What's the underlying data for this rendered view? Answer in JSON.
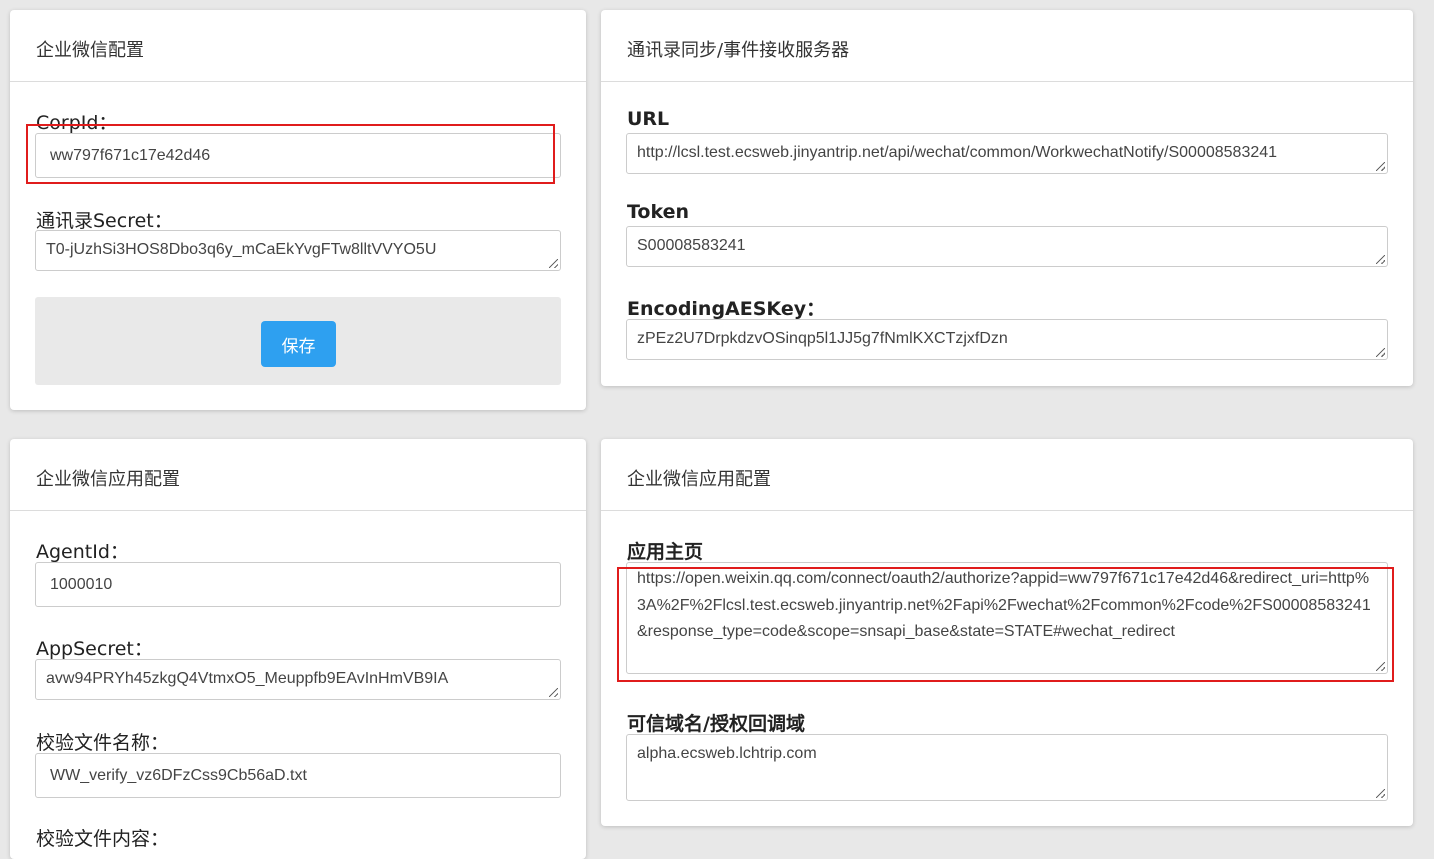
{
  "corp_config": {
    "title": "企业微信配置",
    "corpid_label": "CorpId：",
    "corpid_value": "ww797f671c17e42d46",
    "secret_label": "通讯录Secret：",
    "secret_value": "T0-jUzhSi3HOS8Dbo3q6y_mCaEkYvgFTw8lltVVYO5U",
    "save_label": "保存"
  },
  "sync_server": {
    "title": "通讯录同步/事件接收服务器",
    "url_label": "URL",
    "url_value": "http://lcsl.test.ecsweb.jinyantrip.net/api/wechat/common/WorkwechatNotify/S00008583241",
    "token_label": "Token",
    "token_value": "S00008583241",
    "aeskey_label": "EncodingAESKey：",
    "aeskey_value": "zPEz2U7DrpkdzvOSinqp5l1JJ5g7fNmlKXCTzjxfDzn"
  },
  "app_config_left": {
    "title": "企业微信应用配置",
    "agentid_label": "AgentId：",
    "agentid_value": "1000010",
    "appsecret_label": "AppSecret：",
    "appsecret_value": "avw94PRYh45zkgQ4VtmxO5_Meuppfb9EAvInHmVB9IA",
    "verify_name_label": "校验文件名称：",
    "verify_name_value": "WW_verify_vz6DFzCss9Cb56aD.txt",
    "verify_content_label": "校验文件内容："
  },
  "app_config_right": {
    "title": "企业微信应用配置",
    "homepage_label": "应用主页",
    "homepage_value": "https://open.weixin.qq.com/connect/oauth2/authorize?appid=ww797f671c17e42d46&redirect_uri=http%3A%2F%2Flcsl.test.ecsweb.jinyantrip.net%2Fapi%2Fwechat%2Fcommon%2Fcode%2FS00008583241&response_type=code&scope=snsapi_base&state=STATE#wechat_redirect",
    "trusted_domain_label": "可信域名/授权回调域",
    "trusted_domain_value": "alpha.ecsweb.lchtrip.com"
  },
  "colors": {
    "accent": "#2ea0f0",
    "highlight": "#e01c1c"
  }
}
